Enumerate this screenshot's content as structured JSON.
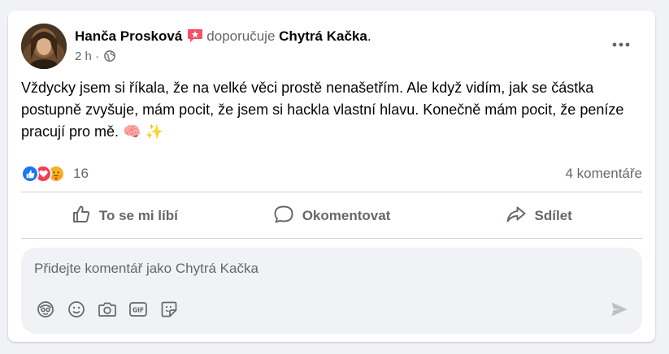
{
  "post": {
    "author": "Hanča Prosková",
    "verb": "doporučuje",
    "page": "Chytrá Kačka",
    "page_suffix": ".",
    "time": "2 h",
    "separator": "·",
    "text": "Vždycky jsem si říkala, že na velké věci prostě nenašetřím. Ale když vidím, jak se částka postupně zvyšuje, mám pocit, že jsem si hackla vlastní hlavu. Konečně mám pocit, že peníze pracují pro mě. 🧠 ✨",
    "audience_icon": "globe-icon",
    "recommend_badge_icon": "recommend-badge-icon"
  },
  "reactions": {
    "icons": [
      "like-icon",
      "love-icon",
      "care-icon"
    ],
    "count": "16",
    "comments": "4 komentáře"
  },
  "actions": {
    "like": "To se mi líbí",
    "comment": "Okomentovat",
    "share": "Sdílet"
  },
  "comment_box": {
    "placeholder": "Přidejte komentář jako Chytrá Kačka",
    "tools": [
      "avatar-sticker-icon",
      "emoji-icon",
      "camera-icon",
      "gif-icon",
      "sticker-icon"
    ],
    "send_icon": "send-icon"
  },
  "colors": {
    "text_primary": "#050505",
    "text_secondary": "#65676b",
    "like_blue": "#1877f2",
    "love_red": "#f33e58",
    "care_yellow": "#f7b125",
    "badge_pink": "#f25268",
    "background": "#f0f2f5"
  }
}
